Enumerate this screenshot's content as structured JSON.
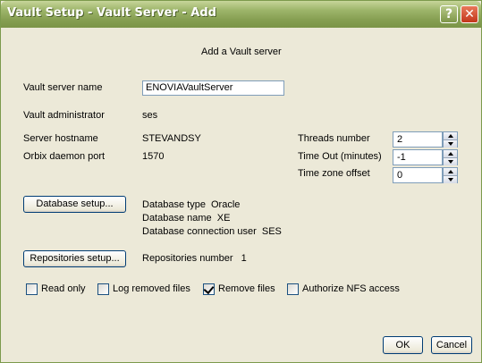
{
  "window": {
    "title": "Vault Setup - Vault Server - Add"
  },
  "heading": "Add a Vault server",
  "fields": {
    "server_name_label": "Vault server name",
    "server_name_value": "ENOVIAVaultServer",
    "admin_label": "Vault administrator",
    "admin_value": "ses",
    "hostname_label": "Server hostname",
    "hostname_value": "STEVANDSY",
    "orbix_label": "Orbix daemon port",
    "orbix_value": "1570",
    "threads_label": "Threads number",
    "threads_value": "2",
    "timeout_label": "Time Out (minutes)",
    "timeout_value": "-1",
    "tz_label": "Time zone offset",
    "tz_value": "0"
  },
  "database": {
    "button": "Database setup...",
    "type_label": "Database type",
    "type_value": "Oracle",
    "name_label": "Database name",
    "name_value": "XE",
    "user_label": "Database connection user",
    "user_value": "SES"
  },
  "repositories": {
    "button": "Repositories setup...",
    "count_label": "Repositories number",
    "count_value": "1"
  },
  "options": [
    {
      "label": "Read only",
      "checked": false
    },
    {
      "label": "Log removed files",
      "checked": false
    },
    {
      "label": "Remove files",
      "checked": true
    },
    {
      "label": "Authorize NFS access",
      "checked": false
    }
  ],
  "footer": {
    "ok": "OK",
    "cancel": "Cancel"
  }
}
